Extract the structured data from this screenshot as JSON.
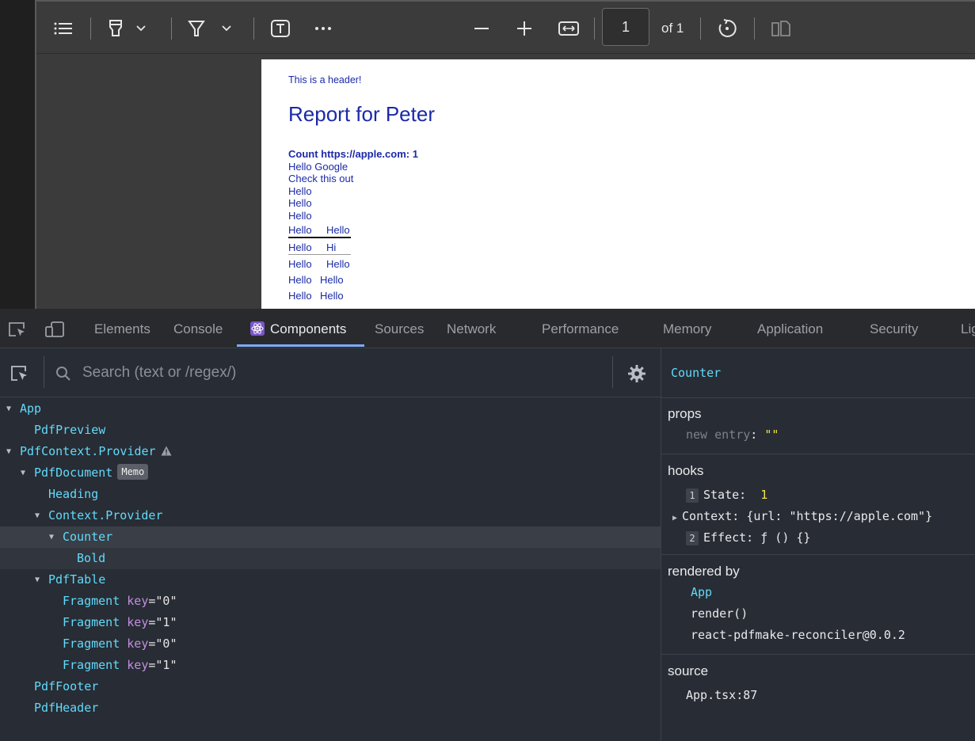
{
  "pdf": {
    "toolbar": {
      "page_number": "1",
      "page_of": "of 1"
    },
    "page": {
      "header": "This is a header!",
      "title": "Report for Peter",
      "count_line": "Count https://apple.com: 1",
      "lines": [
        "Hello Google",
        "Check this out",
        "Hello",
        "Hello",
        "Hello"
      ],
      "table1": [
        [
          "Hello",
          "Hello"
        ],
        [
          "Hello",
          "Hi"
        ]
      ],
      "table2": [
        [
          "Hello",
          "Hello"
        ],
        [
          "Hello",
          "Hello"
        ],
        [
          "Hello",
          "Hello"
        ]
      ]
    }
  },
  "devtools": {
    "tabs": [
      "Elements",
      "Console",
      "Components",
      "Sources",
      "Network",
      "Performance",
      "Memory",
      "Application",
      "Security",
      "Lig"
    ],
    "active_tab": "Components",
    "search": {
      "placeholder": "Search (text or /regex/)"
    },
    "tree": [
      {
        "label": "App",
        "depth": 0,
        "expanded": true
      },
      {
        "label": "PdfPreview",
        "depth": 1
      },
      {
        "label": "PdfContext.Provider",
        "depth": 0,
        "expanded": true,
        "warning": true
      },
      {
        "label": "PdfDocument",
        "depth": 1,
        "expanded": true,
        "badge": "Memo"
      },
      {
        "label": "Heading",
        "depth": 2
      },
      {
        "label": "Context.Provider",
        "depth": 2,
        "expanded": true
      },
      {
        "label": "Counter",
        "depth": 3,
        "expanded": true,
        "selected": true
      },
      {
        "label": "Bold",
        "depth": 4
      },
      {
        "label": "PdfTable",
        "depth": 2,
        "expanded": true
      },
      {
        "label": "Fragment",
        "depth": 3,
        "key": "\"0\""
      },
      {
        "label": "Fragment",
        "depth": 3,
        "key": "\"1\""
      },
      {
        "label": "Fragment",
        "depth": 3,
        "key": "\"0\""
      },
      {
        "label": "Fragment",
        "depth": 3,
        "key": "\"1\""
      },
      {
        "label": "PdfFooter",
        "depth": 1
      },
      {
        "label": "PdfHeader",
        "depth": 1
      }
    ],
    "key_label": "key",
    "inspector": {
      "component": "Counter",
      "props_title": "props",
      "new_entry": "new entry",
      "new_entry_value": "\"\"",
      "hooks_title": "hooks",
      "hook1_num": "1",
      "hook1_name": "State:",
      "hook1_value": "1",
      "hook_context_name": "Context:",
      "hook_context_value": "{url: \"https://apple.com\"}",
      "hook2_num": "2",
      "hook2_name": "Effect:",
      "hook2_value": "ƒ () {}",
      "rendered_by_title": "rendered by",
      "rendered_by": [
        "App",
        "render()",
        "react-pdfmake-reconciler@0.0.2"
      ],
      "source_title": "source",
      "source": "App.tsx:87"
    }
  },
  "colors": {
    "component_name": "#61dafb",
    "pdf_text": "#1a2aa8",
    "key_attr": "#c08fe0",
    "hook_value": "#f5e04a",
    "tab_underline": "#7cacf8"
  }
}
